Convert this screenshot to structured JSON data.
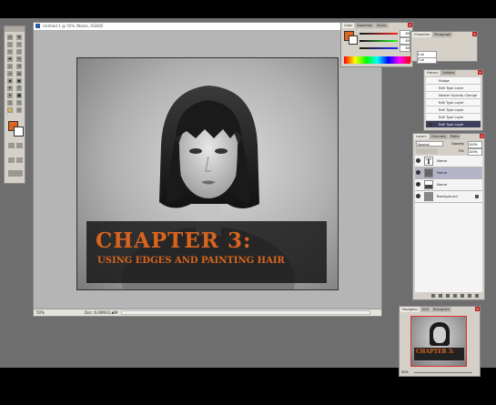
{
  "document": {
    "title": "Untitled-1 @ 50% (Name, RGB/8)",
    "zoom": "50%",
    "doc_size": "Doc: 6.00M/31.4M",
    "chapter_title": "CHAPTER 3:",
    "chapter_subtitle": "USING EDGES AND PAINTING HAIR"
  },
  "color_panel": {
    "tabs": [
      "Color",
      "Swatches",
      "Styles"
    ],
    "r": "80",
    "g": "80",
    "b": "80",
    "fg_color": "#e06420"
  },
  "character_panel": {
    "tabs": [
      "Character",
      "Paragraph"
    ],
    "values": [
      "0 pt",
      "0 pt"
    ]
  },
  "history_panel": {
    "tabs": [
      "History",
      "Actions"
    ],
    "items": [
      "Nudge",
      "Edit Type Layer",
      "Master Opacity Change",
      "Edit Type Layer",
      "Edit Type Layer",
      "Edit Type Layer",
      "Edit Type Layer",
      "Edit Type Layer"
    ]
  },
  "layers_panel": {
    "tabs": [
      "Layers",
      "Channels",
      "Paths"
    ],
    "blend_mode": "Normal",
    "opacity_label": "Opacity:",
    "opacity": "100%",
    "fill_label": "Fill:",
    "fill": "100%",
    "layers": [
      "Name",
      "Name",
      "Name",
      "Background"
    ]
  },
  "navigator_panel": {
    "tabs": [
      "Navigator",
      "Info",
      "Histogram"
    ],
    "zoom": "50%",
    "mini_title": "CHAPTER 3:"
  },
  "colors": {
    "accent_orange": "#d8641e",
    "nav_frame": "#e03030"
  }
}
